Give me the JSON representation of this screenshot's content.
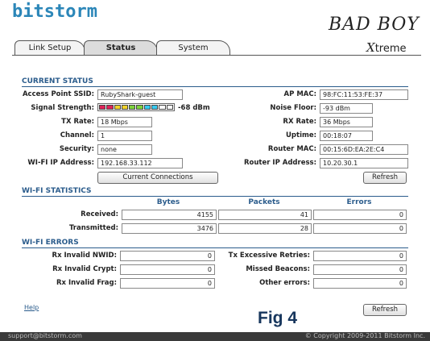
{
  "brand": {
    "name": "bitstorm",
    "product_line1": "BAD BOY",
    "product_x": "X",
    "product_rest": "treme"
  },
  "tabs": [
    {
      "label": "Link Setup",
      "active": false
    },
    {
      "label": "Status",
      "active": true
    },
    {
      "label": "System",
      "active": false
    }
  ],
  "current_status": {
    "title": "CURRENT STATUS",
    "ap_ssid": {
      "label": "Access Point SSID:",
      "value": "RubyShark-guest"
    },
    "signal": {
      "label": "Signal Strength:",
      "value": "-68 dBm",
      "level": 0.7,
      "bar_colors": [
        "#e0245a",
        "#e0245a",
        "#f1d22a",
        "#f1d22a",
        "#7ed33b",
        "#7ed33b",
        "#35c9ef",
        "#35c9ef",
        "#ffffff",
        "#ffffff"
      ]
    },
    "tx_rate": {
      "label": "TX Rate:",
      "value": "18 Mbps"
    },
    "channel": {
      "label": "Channel:",
      "value": "1"
    },
    "security": {
      "label": "Security:",
      "value": "none"
    },
    "wifi_ip": {
      "label": "WI-FI IP Address:",
      "value": "192.168.33.112"
    },
    "ap_mac": {
      "label": "AP MAC:",
      "value": "98:FC:11:53:FE:37"
    },
    "noise_floor": {
      "label": "Noise Floor:",
      "value": "-93 dBm"
    },
    "rx_rate": {
      "label": "RX Rate:",
      "value": "36 Mbps"
    },
    "uptime": {
      "label": "Uptime:",
      "value": "00:18:07"
    },
    "router_mac": {
      "label": "Router MAC:",
      "value": "00:15:6D:EA:2E:C4"
    },
    "router_ip": {
      "label": "Router IP Address:",
      "value": "10.20.30.1"
    },
    "connections_button": "Current Connections",
    "refresh_button": "Refresh"
  },
  "wifi_stats": {
    "title": "WI-FI STATISTICS",
    "columns": [
      "Bytes",
      "Packets",
      "Errors"
    ],
    "rows": [
      {
        "label": "Received:",
        "bytes": "4155",
        "packets": "41",
        "errors": "0"
      },
      {
        "label": "Transmitted:",
        "bytes": "3476",
        "packets": "28",
        "errors": "0"
      }
    ]
  },
  "wifi_errors": {
    "title": "WI-FI ERRORS",
    "rx_invalid_nwid": {
      "label": "Rx Invalid NWID:",
      "value": "0"
    },
    "rx_invalid_crypt": {
      "label": "Rx Invalid Crypt:",
      "value": "0"
    },
    "rx_invalid_frag": {
      "label": "Rx Invalid Frag:",
      "value": "0"
    },
    "tx_excessive_retries": {
      "label": "Tx Excessive Retries:",
      "value": "0"
    },
    "missed_beacons": {
      "label": "Missed Beacons:",
      "value": "0"
    },
    "other_errors": {
      "label": "Other errors:",
      "value": "0"
    }
  },
  "help_link": "Help",
  "bottom_refresh": "Refresh",
  "figure_caption": "Fig 4",
  "footer": {
    "support_email": "support@bitstorm.com",
    "copyright": "© Copyright 2009-2011 Bitstorm Inc."
  }
}
